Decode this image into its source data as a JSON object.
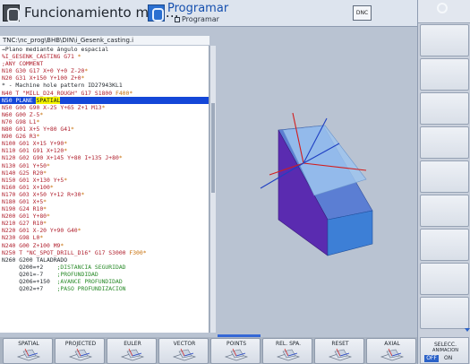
{
  "header": {
    "mode_title": "Funcionamiento man…",
    "program_title": "Programar",
    "program_subtitle": "Programar",
    "dnc_label": "DNC"
  },
  "program": {
    "path": "TNC:\\nc_prog\\BHB\\DIN\\i_Gesenk_casting.i",
    "lines": [
      {
        "segments": [
          {
            "text": "→Plano mediante ángulo espacial",
            "cls": "c-dark"
          }
        ]
      },
      {
        "segments": [
          {
            "text": "%I_GESENK_CASTING G71 ",
            "cls": "c-red"
          },
          {
            "text": "*",
            "cls": "c-org"
          }
        ]
      },
      {
        "segments": [
          {
            "text": ";ANY COMMENT",
            "cls": "c-red"
          }
        ]
      },
      {
        "segments": [
          {
            "text": "N10 G30 G17 X+0 Y+0 Z-20",
            "cls": "c-red"
          },
          {
            "text": "*",
            "cls": "c-org"
          }
        ]
      },
      {
        "segments": [
          {
            "text": "N20 G31 X+150 Y+100 Z+0",
            "cls": "c-red"
          },
          {
            "text": "*",
            "cls": "c-org"
          }
        ]
      },
      {
        "segments": [
          {
            "text": "* - Machine hole pattern ID27943KL1",
            "cls": "c-dark"
          }
        ]
      },
      {
        "segments": [
          {
            "text": "N40 T \"MILL_D24_ROUGH\" G17 S1800 ",
            "cls": "c-red"
          },
          {
            "text": "F400*",
            "cls": "c-org"
          }
        ]
      },
      {
        "selected": true,
        "segments": [
          {
            "text": "N50 PLANE ",
            "cls": ""
          },
          {
            "text": "SPATIAL",
            "cls": "hl"
          }
        ]
      },
      {
        "segments": [
          {
            "text": "N50 G00 G90 X-25 Y+65 Z+1 M13",
            "cls": "c-red"
          },
          {
            "text": "*",
            "cls": "c-org"
          }
        ]
      },
      {
        "segments": [
          {
            "text": "N60 G00 Z-5",
            "cls": "c-red"
          },
          {
            "text": "*",
            "cls": "c-org"
          }
        ]
      },
      {
        "segments": [
          {
            "text": "N70 G98 L1",
            "cls": "c-red"
          },
          {
            "text": "*",
            "cls": "c-org"
          }
        ]
      },
      {
        "segments": [
          {
            "text": "N80 G01 X+5 Y+80 G41",
            "cls": "c-red"
          },
          {
            "text": "*",
            "cls": "c-org"
          }
        ]
      },
      {
        "segments": [
          {
            "text": "N90 G26 R3",
            "cls": "c-red"
          },
          {
            "text": "*",
            "cls": "c-org"
          }
        ]
      },
      {
        "segments": [
          {
            "text": "N100 G01 X+15 Y+90",
            "cls": "c-red"
          },
          {
            "text": "*",
            "cls": "c-org"
          }
        ]
      },
      {
        "segments": [
          {
            "text": "N110 G01 G91 X+120",
            "cls": "c-red"
          },
          {
            "text": "*",
            "cls": "c-org"
          }
        ]
      },
      {
        "segments": [
          {
            "text": "N120 G02 G90 X+145 Y+80 I+135 J+80",
            "cls": "c-red"
          },
          {
            "text": "*",
            "cls": "c-org"
          }
        ]
      },
      {
        "segments": [
          {
            "text": "N130 G01 Y+50",
            "cls": "c-red"
          },
          {
            "text": "*",
            "cls": "c-org"
          }
        ]
      },
      {
        "segments": [
          {
            "text": "N140 G25 R20",
            "cls": "c-red"
          },
          {
            "text": "*",
            "cls": "c-org"
          }
        ]
      },
      {
        "segments": [
          {
            "text": "N150 G01 X+130 Y+5",
            "cls": "c-red"
          },
          {
            "text": "*",
            "cls": "c-org"
          }
        ]
      },
      {
        "segments": [
          {
            "text": "N160 G01 X+100",
            "cls": "c-red"
          },
          {
            "text": "*",
            "cls": "c-org"
          }
        ]
      },
      {
        "segments": [
          {
            "text": "N170 G03 X+50 Y+12 R+30",
            "cls": "c-red"
          },
          {
            "text": "*",
            "cls": "c-org"
          }
        ]
      },
      {
        "segments": [
          {
            "text": "N180 G01 X+5",
            "cls": "c-red"
          },
          {
            "text": "*",
            "cls": "c-org"
          }
        ]
      },
      {
        "segments": [
          {
            "text": "N190 G24 R10",
            "cls": "c-red"
          },
          {
            "text": "*",
            "cls": "c-org"
          }
        ]
      },
      {
        "segments": [
          {
            "text": "N200 G01 Y+80",
            "cls": "c-red"
          },
          {
            "text": "*",
            "cls": "c-org"
          }
        ]
      },
      {
        "segments": [
          {
            "text": "N210 G27 R10",
            "cls": "c-red"
          },
          {
            "text": "*",
            "cls": "c-org"
          }
        ]
      },
      {
        "segments": [
          {
            "text": "N220 G01 X-20 Y+90 G40",
            "cls": "c-red"
          },
          {
            "text": "*",
            "cls": "c-org"
          }
        ]
      },
      {
        "segments": [
          {
            "text": "N230 G98 L0",
            "cls": "c-red"
          },
          {
            "text": "*",
            "cls": "c-org"
          }
        ]
      },
      {
        "segments": [
          {
            "text": "N240 G00 Z+100 M9",
            "cls": "c-red"
          },
          {
            "text": "*",
            "cls": "c-org"
          }
        ]
      },
      {
        "segments": [
          {
            "text": "N250 T \"NC_SPOT_DRILL_D16\" G17 S3000 ",
            "cls": "c-red"
          },
          {
            "text": "F300*",
            "cls": "c-org"
          }
        ]
      },
      {
        "segments": [
          {
            "text": "N260 G200 TALADRADO",
            "cls": "c-dark"
          }
        ]
      },
      {
        "segments": [
          {
            "text": "     Q200=+2    ",
            "cls": "c-dark"
          },
          {
            "text": ";DISTANCIA SEGURIDAD",
            "cls": "c-grn"
          }
        ]
      },
      {
        "segments": [
          {
            "text": "     Q201=-7    ",
            "cls": "c-dark"
          },
          {
            "text": ";PROFUNDIDAD",
            "cls": "c-grn"
          }
        ]
      },
      {
        "segments": [
          {
            "text": "     Q206=+150  ",
            "cls": "c-dark"
          },
          {
            "text": ";AVANCE PROFUNDIDAD",
            "cls": "c-grn"
          }
        ]
      },
      {
        "segments": [
          {
            "text": "     Q202=+7    ",
            "cls": "c-dark"
          },
          {
            "text": ";PASO PROFUNDIZACION",
            "cls": "c-grn"
          }
        ]
      }
    ]
  },
  "softkeys": [
    "SPATIAL",
    "PROJECTED",
    "EULER",
    "VECTOR",
    "POINTS",
    "REL. SPA.",
    "RESET",
    "AXIAL"
  ],
  "right_softkey": {
    "line1": "SELECC.",
    "line2": "ANIMACION",
    "off": "OFF",
    "on": "ON"
  },
  "colors": {
    "accent": "#1447d8",
    "highlight": "#f4f400",
    "block_top": "#5b7ed3",
    "block_front": "#5a2bb0",
    "block_side": "#3d7fd6",
    "plane": "#9ec4ee",
    "axis_red": "#d21d1d",
    "axis_blue": "#1f3fc2"
  },
  "icons": {
    "mode": "machine-mode-icon",
    "program": "program-mode-icon",
    "settings": "gear-icon"
  }
}
